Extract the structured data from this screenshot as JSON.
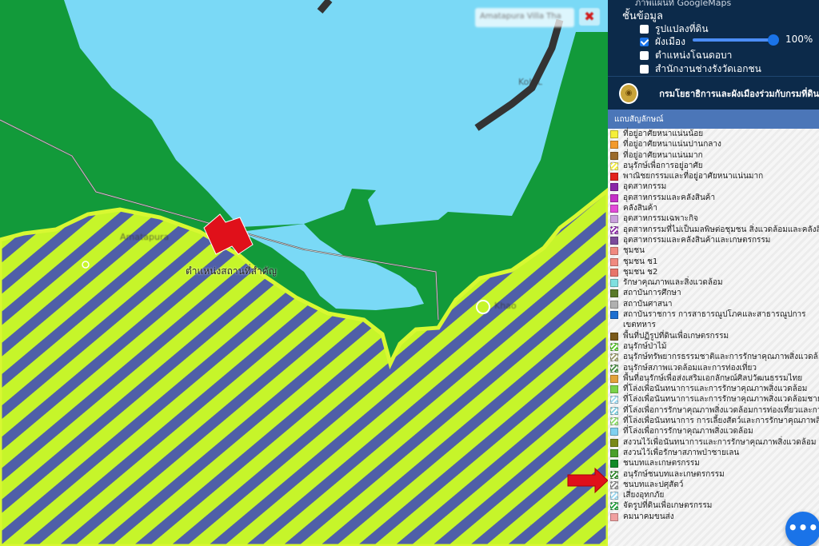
{
  "map": {
    "search_placeholder": "Amatapura Villa Tha",
    "close_glyph": "✖",
    "landmark_label": "ตำแหน่งสถานที่สำคัญ",
    "faint_labels": [
      "Koh L",
      "Amatapura",
      "Khao"
    ],
    "arrow_color": "#e0101a"
  },
  "layers": {
    "cut_label": "ภาพแผนที่ GoogleMaps",
    "title": "ชั้นข้อมูล",
    "items": [
      {
        "label": "รูปแปลงที่ดิน",
        "checked": false
      },
      {
        "label": "ผังเมือง",
        "checked": true
      },
      {
        "label": "ตำแหน่งโฉนดอบา",
        "checked": false
      },
      {
        "label": "สำนักงานช่างรังวัดเอกชน",
        "checked": false
      }
    ],
    "opacity_value": "100%"
  },
  "department": {
    "seal_glyph": "◉",
    "name": "กรมโยธาธิการและผังเมืองร่วมกับกรมที่ดิน"
  },
  "legend": {
    "header": "แถบสัญลักษณ์",
    "items": [
      {
        "label": "ที่อยู่อาศัยหนาแน่นน้อย",
        "color": "#f5ef3a",
        "hatch": false
      },
      {
        "label": "ที่อยู่อาศัยหนาแน่นปานกลาง",
        "color": "#f39a2b",
        "hatch": false
      },
      {
        "label": "ที่อยู่อาศัยหนาแน่นมาก",
        "color": "#9b6b2c",
        "hatch": false
      },
      {
        "label": "อนุรักษ์เพื่อการอยู่อาศัย",
        "color": "#f5ef3a",
        "hatch": true
      },
      {
        "label": "พาณิชยกรรมและที่อยู่อาศัยหนาแน่นมาก",
        "color": "#e3211c",
        "hatch": false
      },
      {
        "label": "อุตสาหกรรม",
        "color": "#8b28a8",
        "hatch": false
      },
      {
        "label": "อุตสาหกรรมและคลังสินค้า",
        "color": "#c52fc8",
        "hatch": false
      },
      {
        "label": "คลังสินค้า",
        "color": "#e24ad8",
        "hatch": false
      },
      {
        "label": "อุตสาหกรรมเฉพาะกิจ",
        "color": "#c9a0dc",
        "hatch": false
      },
      {
        "label": "อุตสาหกรรมที่ไม่เป็นมลพิษต่อชุมชน สิ่งแวดล้อมและคลังสินค้า",
        "color": "#8b28a8",
        "hatch": true
      },
      {
        "label": "อุตสาหกรรมและคลังสินค้าและเกษตรกรรม",
        "color": "#7b4b9b",
        "hatch": false
      },
      {
        "label": "ชุมชน",
        "color": "#f08a80",
        "hatch": false
      },
      {
        "label": "ชุมชน ช1",
        "color": "#f08a80",
        "hatch": false
      },
      {
        "label": "ชุมชน ช2",
        "color": "#e8756a",
        "hatch": false
      },
      {
        "label": "รักษาคุณภาพและสิ่งแวดล้อม",
        "color": "#7fe0e0",
        "hatch": false
      },
      {
        "label": "สถาบันการศึกษา",
        "color": "#5a7a2a",
        "hatch": false
      },
      {
        "label": "สถาบันศาสนา",
        "color": "#b0b0b0",
        "hatch": false
      },
      {
        "label": "สถาบันราชการ การสาธารณูปโภคและสาธารณูปการ",
        "color": "#1e6fd0",
        "hatch": false
      },
      {
        "label": "เขตทหาร",
        "color": "",
        "hatch": false
      },
      {
        "label": "พื้นที่ปฏิรูปที่ดินเพื่อเกษตรกรรม",
        "color": "#7a5a1a",
        "hatch": false
      },
      {
        "label": "อนุรักษ์ป่าไม้",
        "color": "#56c42a",
        "hatch": true
      },
      {
        "label": "อนุรักษ์ทรัพยากรธรรมชาติและการรักษาคุณภาพสิ่งแวดล้อม",
        "color": "#9a9a6a",
        "hatch": true
      },
      {
        "label": "อนุรักษ์สภาพแวดล้อมและการท่องเที่ยว",
        "color": "#3f8a3a",
        "hatch": true
      },
      {
        "label": "พื้นที่อนุรักษ์เพื่อส่งเสริมเอกลักษณ์ศิลปวัฒนธรรมไทย",
        "color": "#e3a23a",
        "hatch": false
      },
      {
        "label": "ที่โล่งเพื่อนันทนาการและการรักษาคุณภาพสิ่งแวดล้อม",
        "color": "#7ad34a",
        "hatch": false
      },
      {
        "label": "ที่โล่งเพื่อนันทนาการและการรักษาคุณภาพสิ่งแวดล้อมชายฝั่งทะเล",
        "color": "#9ad8f0",
        "hatch": true
      },
      {
        "label": "ที่โล่งเพื่อการรักษาคุณภาพสิ่งแวดล้อมการท่องเที่ยวและการป",
        "color": "#7fd0e0",
        "hatch": true
      },
      {
        "label": "ที่โล่งเพื่อนันทนาการ การเลี้ยงสัตว์และการรักษาคุณภาพสิ่งแวดล้อม",
        "color": "#8ee06a",
        "hatch": true
      },
      {
        "label": "ที่โล่งเพื่อการรักษาคุณภาพสิ่งแวดล้อม",
        "color": "#7fd0f0",
        "hatch": false
      },
      {
        "label": "สงวนไว้เพื่อนันทนาการและการรักษาคุณภาพสิ่งแวดล้อม",
        "color": "#7a8a1a",
        "hatch": false
      },
      {
        "label": "สงวนไว้เพื่อรักษาสภาพป่าชายเลน",
        "color": "#4aa02a",
        "hatch": false
      },
      {
        "label": "ชนบทและเกษตรกรรม",
        "color": "#128a28",
        "hatch": false
      },
      {
        "label": "อนุรักษ์ชนบทและเกษตรกรรม",
        "color": "#2e8a2a",
        "hatch": true
      },
      {
        "label": "ชนบทและปศุสัตว์",
        "color": "#8a8a8a",
        "hatch": true
      },
      {
        "label": "เสี่ยงอุทกภัย",
        "color": "#9ad8f0",
        "hatch": true
      },
      {
        "label": "จัดรูปที่ดินเพื่อเกษตรกรรม",
        "color": "#1fa03a",
        "hatch": true
      },
      {
        "label": "คมนาคมขนส่ง",
        "color": "#f0a0a0",
        "hatch": false
      }
    ]
  },
  "fab": {
    "glyph": "•••"
  }
}
